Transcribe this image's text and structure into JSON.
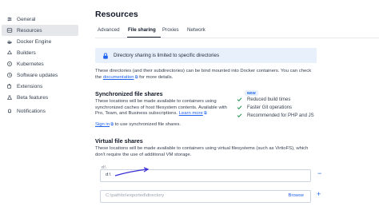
{
  "sidebar": {
    "items": [
      {
        "label": "General",
        "icon": "sliders-icon"
      },
      {
        "label": "Resources",
        "icon": "resources-icon",
        "active": true
      },
      {
        "label": "Docker Engine",
        "icon": "whale-icon"
      },
      {
        "label": "Builders",
        "icon": "builders-icon"
      },
      {
        "label": "Kubernetes",
        "icon": "kubernetes-icon"
      },
      {
        "label": "Software updates",
        "icon": "clock-icon"
      },
      {
        "label": "Extensions",
        "icon": "puzzle-icon"
      },
      {
        "label": "Beta features",
        "icon": "flask-icon"
      },
      {
        "label": "Notifications",
        "icon": "bell-icon"
      }
    ]
  },
  "main": {
    "title": "Resources",
    "tabs": [
      {
        "label": "Advanced"
      },
      {
        "label": "File sharing",
        "active": true
      },
      {
        "label": "Proxies"
      },
      {
        "label": "Network"
      }
    ],
    "info_banner": "Directory sharing is limited to specific directories",
    "intro_line1": "These directories (and their subdirectories) can be bind mounted into Docker containers. You can check",
    "intro_pre": "the ",
    "intro_link": "documentation",
    "intro_post": " for more details.",
    "sync": {
      "title": "Synchronized file shares",
      "badge": "NEW",
      "line1": "These locations will be made available to containers using",
      "line2": "synchronized caches of host filesystem contents. Available with",
      "line3_pre": "Pro, Team, and Business subscriptions. ",
      "learn_more": "Learn more",
      "sign_in": "Sign in",
      "sign_in_post": " to use synchronized file shares.",
      "benefits": [
        "Reduced build times",
        "Faster Git operations",
        "Recommended for PHP and JS"
      ]
    },
    "virtual": {
      "title": "Virtual file shares",
      "line1": "These locations will be made available to containers using virtual filesystems (such as VirtioFS), which",
      "line2": "don't require the use of additional VM storage.",
      "field_label": "d:\\",
      "field_value": "d:\\",
      "new_placeholder": "C:\\path\\to\\exported\\directory",
      "browse": "Browse",
      "remove": "−",
      "add": "+"
    }
  },
  "colors": {
    "accent": "#1d63ed",
    "info_bg": "#e7f0fb",
    "active_bg": "#e5e7eb",
    "check": "#1a8f4a"
  }
}
